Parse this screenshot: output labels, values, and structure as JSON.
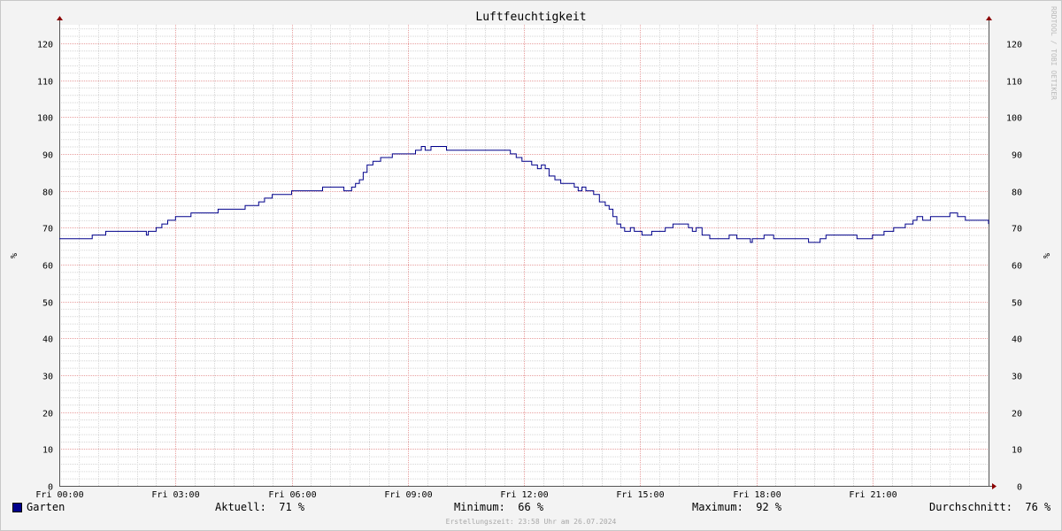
{
  "chart_data": {
    "type": "line",
    "title": "Luftfeuchtigkeit",
    "ylabel": "%",
    "ylim": [
      0,
      125
    ],
    "yticks": [
      0,
      10,
      20,
      30,
      40,
      50,
      60,
      70,
      80,
      90,
      100,
      110,
      120
    ],
    "xlim_hours": [
      0,
      24
    ],
    "xticks": [
      {
        "hour": 0,
        "label": "Fri 00:00"
      },
      {
        "hour": 3,
        "label": "Fri 03:00"
      },
      {
        "hour": 6,
        "label": "Fri 06:00"
      },
      {
        "hour": 9,
        "label": "Fri 09:00"
      },
      {
        "hour": 12,
        "label": "Fri 12:00"
      },
      {
        "hour": 15,
        "label": "Fri 15:00"
      },
      {
        "hour": 18,
        "label": "Fri 18:00"
      },
      {
        "hour": 21,
        "label": "Fri 21:00"
      }
    ],
    "grid": true,
    "legend_position": "bottom",
    "watermark": "RRDTOOL / TOBI OETIKER",
    "series": [
      {
        "name": "Garten",
        "color": "#00008b",
        "step": true,
        "x": [
          0,
          0.85,
          1.2,
          2.2,
          2.25,
          2.3,
          2.5,
          2.65,
          2.8,
          3.0,
          3.4,
          4.1,
          4.8,
          5.15,
          5.3,
          5.5,
          6.0,
          6.1,
          6.8,
          7.15,
          7.35,
          7.45,
          7.55,
          7.65,
          7.75,
          7.85,
          7.95,
          8.1,
          8.3,
          8.6,
          8.7,
          9.2,
          9.35,
          9.45,
          9.6,
          10.0,
          11.5,
          11.65,
          11.8,
          11.95,
          12.2,
          12.35,
          12.45,
          12.55,
          12.65,
          12.8,
          12.95,
          13.2,
          13.3,
          13.4,
          13.5,
          13.6,
          13.7,
          13.8,
          13.95,
          14.1,
          14.2,
          14.3,
          14.4,
          14.5,
          14.6,
          14.75,
          14.85,
          15.05,
          15.3,
          15.65,
          15.85,
          16.2,
          16.25,
          16.35,
          16.45,
          16.6,
          16.8,
          17.3,
          17.5,
          17.85,
          17.9,
          18.05,
          18.2,
          18.45,
          18.5,
          19.15,
          19.35,
          19.65,
          19.8,
          20.6,
          21.0,
          21.3,
          21.55,
          21.85,
          22.05,
          22.15,
          22.3,
          22.5,
          22.75,
          23.0,
          23.2,
          23.4,
          24.0
        ],
        "values": [
          67,
          68,
          69,
          69,
          68,
          69,
          70,
          71,
          72,
          73,
          74,
          75,
          76,
          77,
          78,
          79,
          80,
          80,
          81,
          81,
          80,
          80,
          81,
          82,
          83,
          85,
          87,
          88,
          89,
          90,
          90,
          91,
          92,
          91,
          92,
          91,
          91,
          90,
          89,
          88,
          87,
          86,
          87,
          86,
          84,
          83,
          82,
          82,
          81,
          80,
          81,
          80,
          80,
          79,
          77,
          76,
          75,
          73,
          71,
          70,
          69,
          70,
          69,
          68,
          69,
          70,
          71,
          71,
          70,
          69,
          70,
          68,
          67,
          68,
          67,
          66,
          67,
          67,
          68,
          67,
          67,
          67,
          66,
          67,
          68,
          67,
          68,
          69,
          70,
          71,
          72,
          73,
          72,
          73,
          73,
          74,
          73,
          72,
          71
        ]
      }
    ]
  },
  "legend": {
    "series_name": "Garten",
    "current": "Aktuell:  71 %",
    "minimum": "Minimum:  66 %",
    "maximum": "Maximum:  92 %",
    "average": "Durchschnitt:  76 %"
  },
  "footer": "Erstellungszeit: 23:58 Uhr am 26.07.2024"
}
